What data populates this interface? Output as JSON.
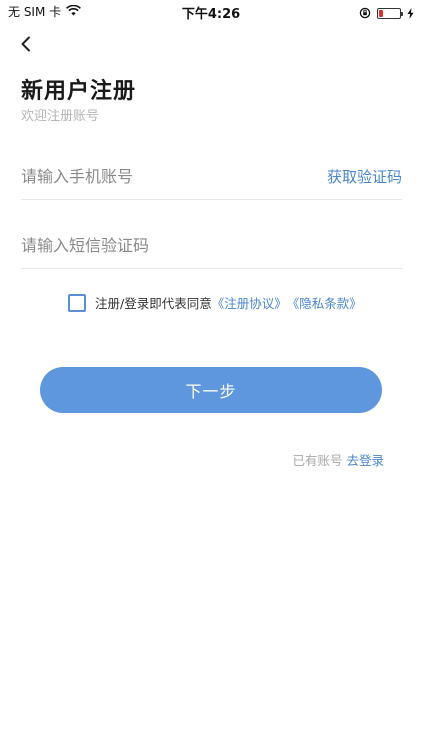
{
  "status_bar": {
    "carrier": "无 SIM 卡",
    "time": "下午4:26",
    "battery_level": 0.2,
    "battery_color": "#e0302b",
    "icons": [
      "wifi-icon",
      "orientation-lock-icon",
      "battery-icon",
      "charging-icon"
    ]
  },
  "nav": {
    "back_icon": "chevron-left-icon"
  },
  "header": {
    "title": "新用户注册",
    "subtitle": "欢迎注册账号"
  },
  "form": {
    "phone": {
      "value": "",
      "placeholder": "请输入手机账号"
    },
    "get_code_label": "获取验证码",
    "sms_code": {
      "value": "",
      "placeholder": "请输入短信验证码"
    },
    "agreement": {
      "checked": false,
      "text": "注册/登录即代表同意",
      "terms_link": "《注册协议》",
      "privacy_link": "《隐私条款》"
    },
    "next_label": "下一步"
  },
  "footer": {
    "login_hint": "已有账号",
    "login_link": "去登录"
  },
  "colors": {
    "accent": "#4a86cf",
    "button": "#5f97de"
  }
}
